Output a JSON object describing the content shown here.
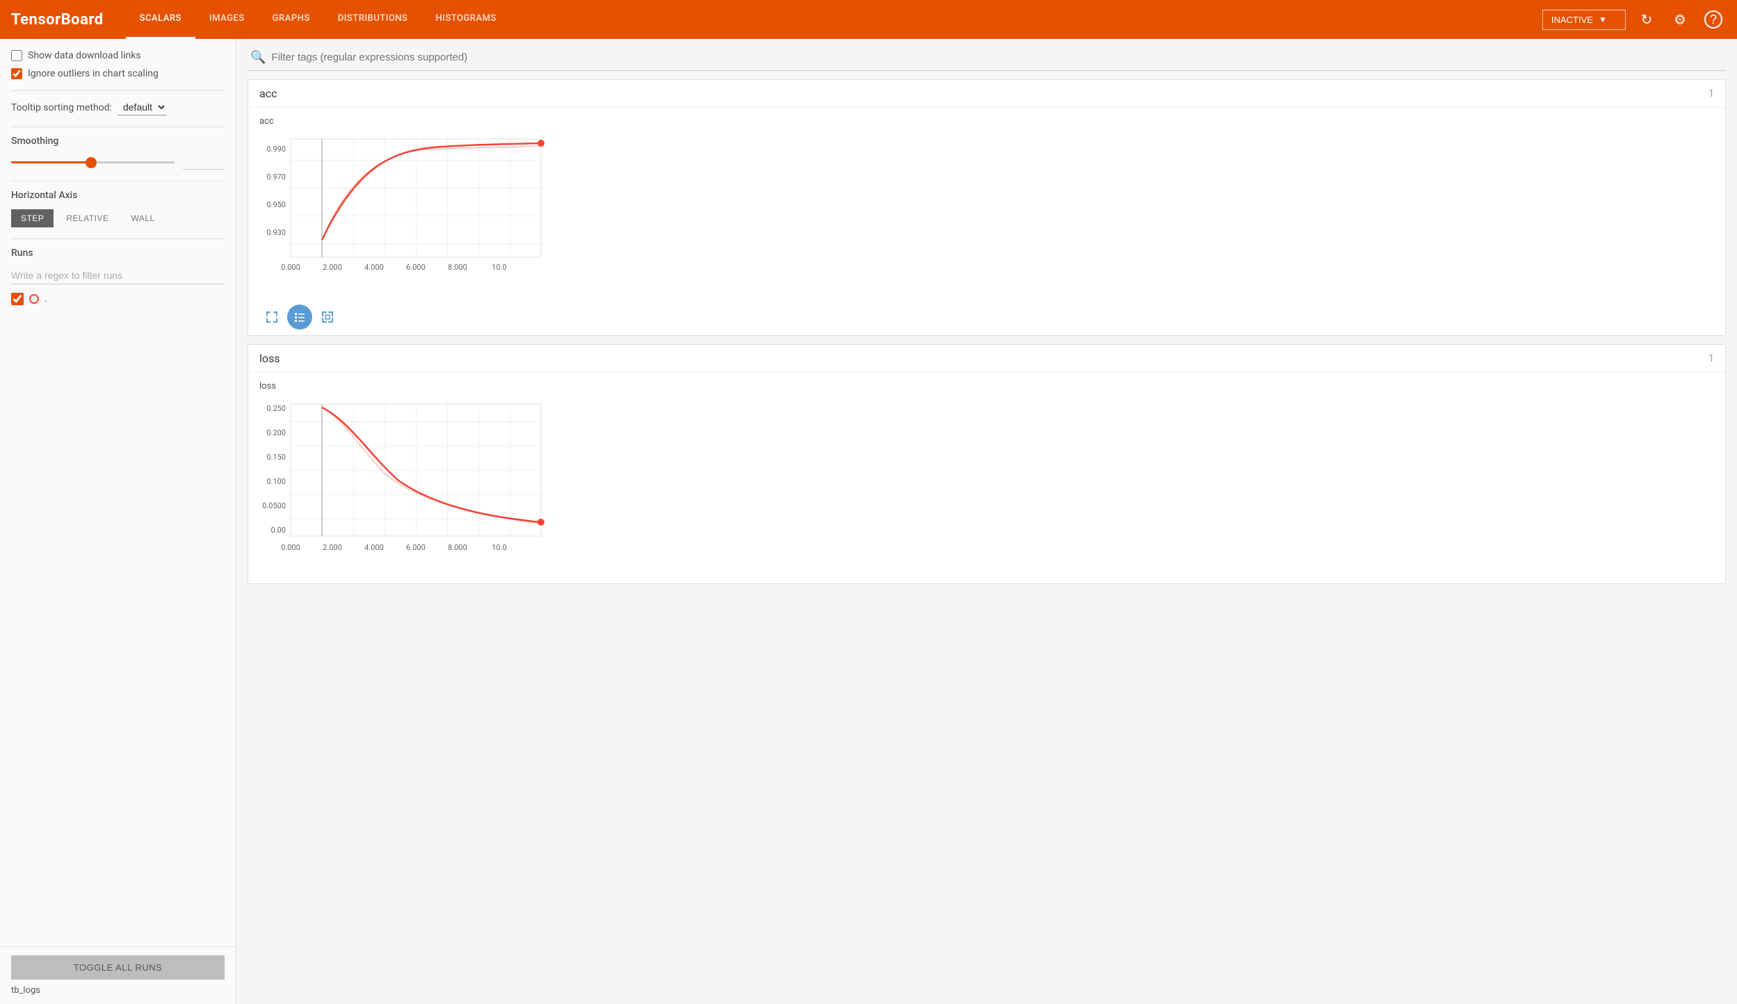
{
  "header": {
    "logo": "TensorBoard",
    "nav": [
      {
        "label": "SCALARS",
        "active": true
      },
      {
        "label": "IMAGES",
        "active": false
      },
      {
        "label": "GRAPHS",
        "active": false
      },
      {
        "label": "DISTRIBUTIONS",
        "active": false
      },
      {
        "label": "HISTOGRAMS",
        "active": false
      }
    ],
    "inactive_label": "INACTIVE",
    "refresh_icon": "↻",
    "settings_icon": "⚙",
    "help_icon": "?"
  },
  "sidebar": {
    "show_download_links_label": "Show data download links",
    "ignore_outliers_label": "Ignore outliers in chart scaling",
    "ignore_outliers_checked": true,
    "tooltip_label": "Tooltip sorting method:",
    "tooltip_value": "default",
    "smoothing_label": "Smoothing",
    "smoothing_value": "0,489",
    "smoothing_percent": 55,
    "horizontal_axis_label": "Horizontal Axis",
    "axis_buttons": [
      {
        "label": "STEP",
        "active": true
      },
      {
        "label": "RELATIVE",
        "active": false
      },
      {
        "label": "WALL",
        "active": false
      }
    ],
    "runs_label": "Runs",
    "runs_filter_placeholder": "Write a regex to filter runs",
    "runs": [
      {
        "name": ".",
        "checked": true
      }
    ],
    "toggle_all_label": "TOGGLE ALL RUNS",
    "tb_logs_label": "tb_logs"
  },
  "main": {
    "search_placeholder": "Filter tags (regular expressions supported)",
    "charts": [
      {
        "title": "acc",
        "count": "1",
        "inner_title": "acc",
        "type": "acc",
        "y_labels": [
          "0.990",
          "0.970",
          "0.950",
          "0.930"
        ],
        "x_labels": [
          "0.000",
          "2.000",
          "4.000",
          "6.000",
          "8.000",
          "10.0"
        ]
      },
      {
        "title": "loss",
        "count": "1",
        "inner_title": "loss",
        "type": "loss",
        "y_labels": [
          "0.250",
          "0.200",
          "0.150",
          "0.100",
          "0.0500",
          "0.00"
        ],
        "x_labels": [
          "0.000",
          "2.000",
          "4.000",
          "6.000",
          "8.000",
          "10.0"
        ]
      }
    ]
  }
}
